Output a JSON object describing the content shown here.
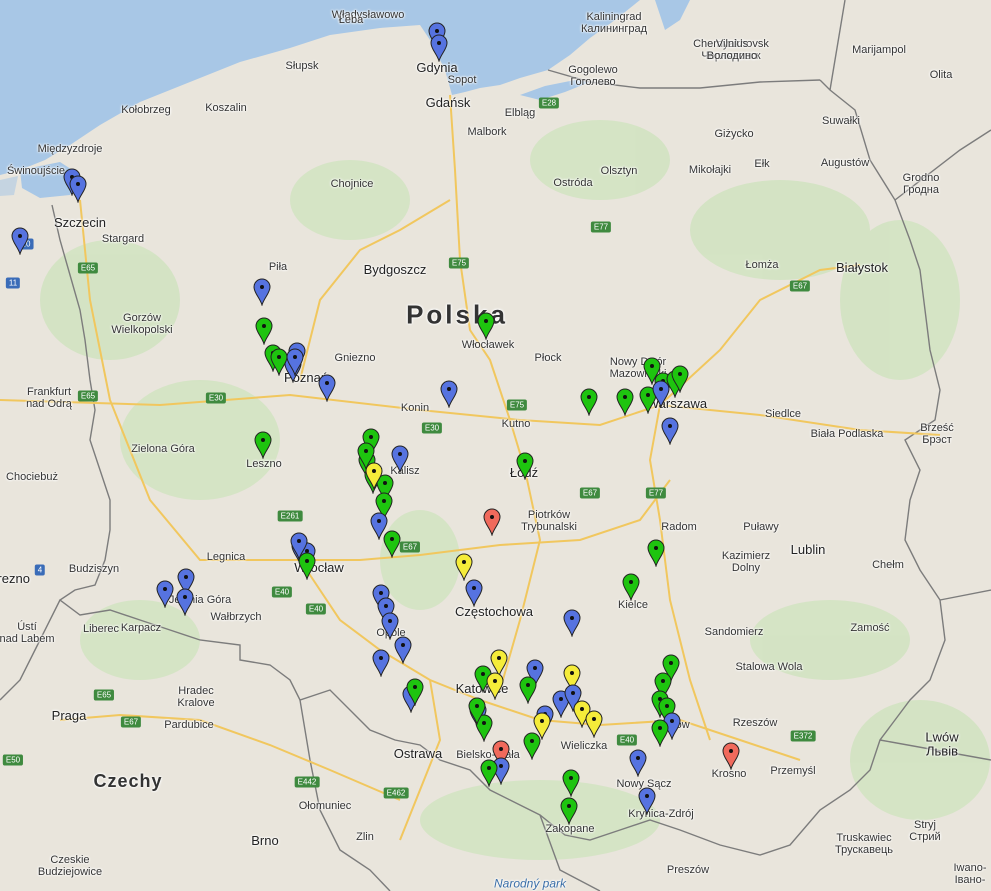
{
  "colors": {
    "land": "#e9e5dc",
    "water": "#a8c7e6",
    "green": "#1ec40f",
    "blue": "#5673e0",
    "yellow": "#f5ec3a",
    "red": "#f06a5c",
    "border": "#7c7c7c"
  },
  "labels": [
    {
      "t": "Władysławowo",
      "c": ""
    },
    {
      "t": "Łeba",
      "c": ""
    },
    {
      "t": "Kaliningrad\nКалининград",
      "c": ""
    },
    {
      "t": "Gdynia",
      "c": "city"
    },
    {
      "t": "Sopot",
      "c": ""
    },
    {
      "t": "Gdańsk",
      "c": "city"
    },
    {
      "t": "Słupsk",
      "c": ""
    },
    {
      "t": "Kołobrzeg",
      "c": ""
    },
    {
      "t": "Koszalin",
      "c": ""
    },
    {
      "t": "Malbork",
      "c": ""
    },
    {
      "t": "Elbląg",
      "c": ""
    },
    {
      "t": "Gogolewo\nГоголево",
      "c": ""
    },
    {
      "t": "Chernyakhovsk\nЧерняховск",
      "c": ""
    },
    {
      "t": "Vilnius\nВолодино",
      "c": ""
    },
    {
      "t": "Marijampol",
      "c": ""
    },
    {
      "t": "Olita",
      "c": ""
    },
    {
      "t": "Suwałki",
      "c": ""
    },
    {
      "t": "Giżycko",
      "c": ""
    },
    {
      "t": "Międzyzdroje",
      "c": ""
    },
    {
      "t": "Świnoujście",
      "c": ""
    },
    {
      "t": "Szczecin",
      "c": "city"
    },
    {
      "t": "Stargard",
      "c": ""
    },
    {
      "t": "Chojnice",
      "c": ""
    },
    {
      "t": "Olsztyn",
      "c": ""
    },
    {
      "t": "Ostróda",
      "c": ""
    },
    {
      "t": "Mikołajki",
      "c": ""
    },
    {
      "t": "Ełk",
      "c": ""
    },
    {
      "t": "Augustów",
      "c": ""
    },
    {
      "t": "Grodno\nГродна",
      "c": ""
    },
    {
      "t": "Piła",
      "c": ""
    },
    {
      "t": "Bydgoszcz",
      "c": "city"
    },
    {
      "t": "Łomża",
      "c": ""
    },
    {
      "t": "Białystok",
      "c": "city"
    },
    {
      "t": "Polska",
      "c": "country"
    },
    {
      "t": "Gorzów\nWielkopolski",
      "c": ""
    },
    {
      "t": "Włocławek",
      "c": ""
    },
    {
      "t": "Gniezno",
      "c": ""
    },
    {
      "t": "Płock",
      "c": ""
    },
    {
      "t": "Nowy Dwór\nMazowiecki",
      "c": ""
    },
    {
      "t": "Frankfurt\nnad Odrą",
      "c": ""
    },
    {
      "t": "Poznań",
      "c": "city"
    },
    {
      "t": "Konin",
      "c": ""
    },
    {
      "t": "Kutno",
      "c": ""
    },
    {
      "t": "Warszawa",
      "c": "city"
    },
    {
      "t": "Siedlce",
      "c": ""
    },
    {
      "t": "Brześć\nБрэст",
      "c": ""
    },
    {
      "t": "Biała Podlaska",
      "c": ""
    },
    {
      "t": "Zielona Góra",
      "c": ""
    },
    {
      "t": "Leszno",
      "c": ""
    },
    {
      "t": "Kalisz",
      "c": ""
    },
    {
      "t": "Łódź",
      "c": "city"
    },
    {
      "t": "Chociebuż",
      "c": ""
    },
    {
      "t": "Piotrków\nTrybunalski",
      "c": ""
    },
    {
      "t": "Radom",
      "c": ""
    },
    {
      "t": "Puławy",
      "c": ""
    },
    {
      "t": "Legnica",
      "c": ""
    },
    {
      "t": "Kazimierz\nDolny",
      "c": ""
    },
    {
      "t": "Lublin",
      "c": "city"
    },
    {
      "t": "Chełm",
      "c": ""
    },
    {
      "t": "Wrocław",
      "c": "city"
    },
    {
      "t": "Budziszyn",
      "c": ""
    },
    {
      "t": "Drezno",
      "c": "city"
    },
    {
      "t": "Jelenia Góra",
      "c": ""
    },
    {
      "t": "Częstochowa",
      "c": "city"
    },
    {
      "t": "Kielce",
      "c": ""
    },
    {
      "t": "Wałbrzych",
      "c": ""
    },
    {
      "t": "Ústí\nnad Labem",
      "c": ""
    },
    {
      "t": "Liberec",
      "c": ""
    },
    {
      "t": "Karpacz",
      "c": ""
    },
    {
      "t": "Opole",
      "c": ""
    },
    {
      "t": "Sandomierz",
      "c": ""
    },
    {
      "t": "Zamość",
      "c": ""
    },
    {
      "t": "Stalowa Wola",
      "c": ""
    },
    {
      "t": "Hradec\nKralove",
      "c": ""
    },
    {
      "t": "Praga",
      "c": "city"
    },
    {
      "t": "Pardubice",
      "c": ""
    },
    {
      "t": "Katowice",
      "c": "city"
    },
    {
      "t": "Tarnów",
      "c": ""
    },
    {
      "t": "Rzeszów",
      "c": ""
    },
    {
      "t": "Lwów\nЛьвів",
      "c": "city"
    },
    {
      "t": "Bielsko-Biała",
      "c": ""
    },
    {
      "t": "Wieliczka",
      "c": ""
    },
    {
      "t": "Ostrawa",
      "c": "city"
    },
    {
      "t": "Nowy Sącz",
      "c": ""
    },
    {
      "t": "Krosno",
      "c": ""
    },
    {
      "t": "Przemyśl",
      "c": ""
    },
    {
      "t": "Czechy",
      "c": "country2"
    },
    {
      "t": "Ołomuniec",
      "c": ""
    },
    {
      "t": "Krynica-Zdrój",
      "c": ""
    },
    {
      "t": "Zakopane",
      "c": ""
    },
    {
      "t": "Stryj\nСтрий",
      "c": ""
    },
    {
      "t": "Truskawiec\nТрускавець",
      "c": ""
    },
    {
      "t": "Zlin",
      "c": ""
    },
    {
      "t": "Brno",
      "c": "city"
    },
    {
      "t": "Preszów",
      "c": ""
    },
    {
      "t": "Iwano-\nІвано-",
      "c": ""
    },
    {
      "t": "Czeskie\nBudziejowice",
      "c": ""
    },
    {
      "t": "Narodný park",
      "c": "water"
    }
  ],
  "roads": [
    {
      "t": "E28"
    },
    {
      "t": "E77"
    },
    {
      "t": "E75"
    },
    {
      "t": "E65"
    },
    {
      "t": "20"
    },
    {
      "t": "E65"
    },
    {
      "t": "11"
    },
    {
      "t": "E65"
    },
    {
      "t": "E30"
    },
    {
      "t": "E30"
    },
    {
      "t": "E75"
    },
    {
      "t": "E67"
    },
    {
      "t": "E67"
    },
    {
      "t": "E77"
    },
    {
      "t": "E67"
    },
    {
      "t": "E261"
    },
    {
      "t": "E67"
    },
    {
      "t": "4"
    },
    {
      "t": "E40"
    },
    {
      "t": "E40"
    },
    {
      "t": "E65"
    },
    {
      "t": "E67"
    },
    {
      "t": "E50"
    },
    {
      "t": "E442"
    },
    {
      "t": "E462"
    },
    {
      "t": "E40"
    },
    {
      "t": "E40"
    },
    {
      "t": "E372"
    },
    {
      "t": "E50"
    }
  ],
  "markers": [
    [
      "b",
      437,
      50
    ],
    [
      "b",
      439,
      62
    ],
    [
      "b",
      72,
      196
    ],
    [
      "b",
      78,
      203
    ],
    [
      "b",
      20,
      255
    ],
    [
      "b",
      262,
      306
    ],
    [
      "g",
      264,
      345
    ],
    [
      "g",
      273,
      372
    ],
    [
      "b",
      297,
      370
    ],
    [
      "b",
      293,
      383
    ],
    [
      "g",
      279,
      376
    ],
    [
      "b",
      327,
      402
    ],
    [
      "g",
      486,
      340
    ],
    [
      "b",
      449,
      408
    ],
    [
      "g",
      589,
      416
    ],
    [
      "g",
      625,
      416
    ],
    [
      "g",
      648,
      414
    ],
    [
      "g",
      652,
      385
    ],
    [
      "g",
      663,
      400
    ],
    [
      "g",
      675,
      398
    ],
    [
      "b",
      661,
      408
    ],
    [
      "b",
      670,
      445
    ],
    [
      "g",
      371,
      456
    ],
    [
      "b",
      400,
      473
    ],
    [
      "g",
      367,
      479
    ],
    [
      "g",
      373,
      494
    ],
    [
      "g",
      385,
      502
    ],
    [
      "g",
      384,
      520
    ],
    [
      "b",
      379,
      540
    ],
    [
      "g",
      392,
      558
    ],
    [
      "y",
      374,
      490
    ],
    [
      "g",
      263,
      459
    ],
    [
      "g",
      525,
      480
    ],
    [
      "r",
      492,
      536
    ],
    [
      "b",
      300,
      565
    ],
    [
      "b",
      307,
      570
    ],
    [
      "g",
      307,
      580
    ],
    [
      "y",
      464,
      581
    ],
    [
      "b",
      474,
      607
    ],
    [
      "b",
      381,
      612
    ],
    [
      "b",
      386,
      625
    ],
    [
      "b",
      390,
      640
    ],
    [
      "b",
      381,
      677
    ],
    [
      "b",
      403,
      664
    ],
    [
      "b",
      165,
      608
    ],
    [
      "b",
      186,
      596
    ],
    [
      "b",
      185,
      616
    ],
    [
      "b",
      572,
      637
    ],
    [
      "g",
      656,
      567
    ],
    [
      "g",
      631,
      601
    ],
    [
      "b",
      411,
      713
    ],
    [
      "g",
      415,
      706
    ],
    [
      "g",
      483,
      693
    ],
    [
      "y",
      499,
      677
    ],
    [
      "y",
      495,
      700
    ],
    [
      "b",
      478,
      729
    ],
    [
      "g",
      484,
      742
    ],
    [
      "g",
      477,
      725
    ],
    [
      "r",
      501,
      768
    ],
    [
      "b",
      501,
      785
    ],
    [
      "g",
      489,
      787
    ],
    [
      "g",
      532,
      760
    ],
    [
      "b",
      535,
      687
    ],
    [
      "g",
      528,
      704
    ],
    [
      "y",
      572,
      692
    ],
    [
      "b",
      561,
      718
    ],
    [
      "b",
      573,
      712
    ],
    [
      "b",
      545,
      733
    ],
    [
      "y",
      542,
      740
    ],
    [
      "y",
      582,
      728
    ],
    [
      "y",
      594,
      738
    ],
    [
      "g",
      571,
      797
    ],
    [
      "g",
      569,
      825
    ],
    [
      "b",
      638,
      777
    ],
    [
      "b",
      647,
      815
    ],
    [
      "g",
      671,
      682
    ],
    [
      "g",
      663,
      700
    ],
    [
      "g",
      660,
      718
    ],
    [
      "g",
      667,
      725
    ],
    [
      "b",
      672,
      740
    ],
    [
      "g",
      660,
      747
    ],
    [
      "r",
      731,
      770
    ],
    [
      "b",
      299,
      560
    ],
    [
      "b",
      295,
      376
    ],
    [
      "g",
      680,
      393
    ],
    [
      "g",
      366,
      470
    ]
  ]
}
